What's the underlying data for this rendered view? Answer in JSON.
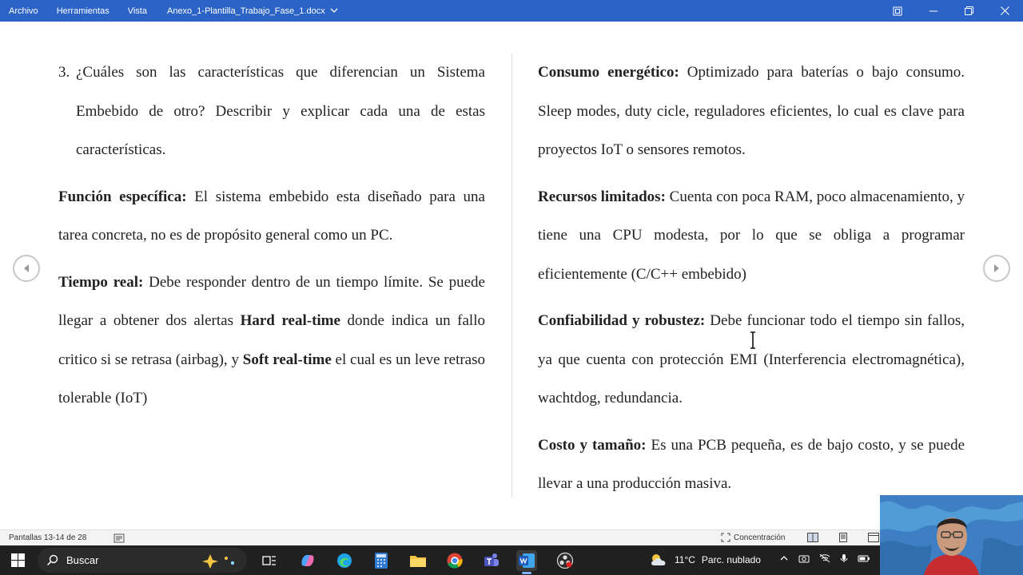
{
  "titlebar": {
    "menu": [
      "Archivo",
      "Herramientas",
      "Vista"
    ],
    "document_name": "Anexo_1-Plantilla_Trabajo_Fase_1.docx"
  },
  "left_column": {
    "question_number": "3.",
    "question_text": "¿Cuáles son las características que diferencian un Sistema Embebido de otro? Describir y explicar cada una de estas características.",
    "paragraphs": [
      {
        "bold": "Función específica:",
        "text": " El sistema embebido esta diseñado para una tarea concreta, no es de propósito general como un PC."
      },
      {
        "bold": "Tiempo real:",
        "text1": " Debe responder dentro de un tiempo límite. Se puede llegar a obtener dos alertas ",
        "bold2": "Hard real-time",
        "text2": " donde indica un fallo critico si se retrasa (airbag), y ",
        "bold3": "Soft real-time",
        "text3": " el cual es un leve retraso tolerable (IoT)"
      }
    ]
  },
  "right_column": {
    "paragraphs": [
      {
        "bold": "Consumo energético:",
        "text": " Optimizado para baterías o bajo consumo. Sleep modes, duty cicle, reguladores eficientes, lo cual es clave para proyectos IoT o sensores remotos."
      },
      {
        "bold": "Recursos limitados:",
        "text": " Cuenta con poca RAM, poco almacenamiento, y tiene una CPU modesta, por lo que se obliga a programar eficientemente (C/C++ embebido)"
      },
      {
        "bold": "Confiabilidad y robustez:",
        "text": " Debe funcionar todo el tiempo sin fallos, ya que cuenta con protección EMI (Interferencia electromagnética), wachtdog, redundancia."
      },
      {
        "bold": "Costo y tamaño:",
        "text": " Es una PCB pequeña, es de bajo costo, y se puede llevar a una producción masiva."
      }
    ]
  },
  "statusbar": {
    "pages": "Pantallas 13-14 de 28",
    "focus_label": "Concentración"
  },
  "taskbar": {
    "search_label": "Buscar",
    "weather_temp": "11°C",
    "weather_desc": "Parc. nublado"
  },
  "colors": {
    "titlebar": "#2b63c6",
    "taskbar": "#202020",
    "text": "#222222"
  }
}
